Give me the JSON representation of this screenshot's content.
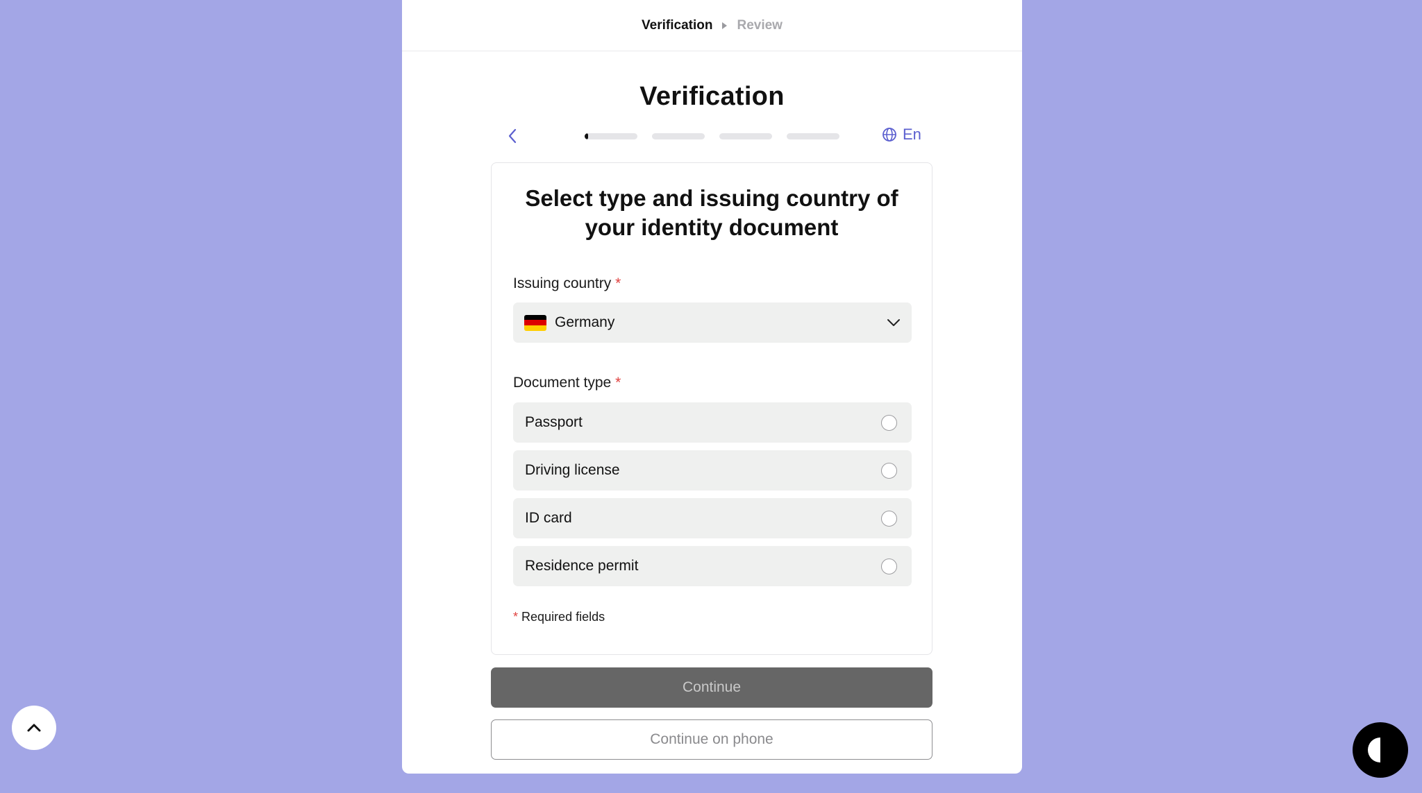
{
  "breadcrumb": {
    "steps": [
      "Verification",
      "Review"
    ],
    "active_index": 0
  },
  "page": {
    "title": "Verification"
  },
  "progress": {
    "segments": 4,
    "current_fraction": 0.06
  },
  "language": {
    "label": "En",
    "icon": "globe-icon"
  },
  "card": {
    "title": "Select type and issuing country of your identity document",
    "country_label": "Issuing country",
    "required_mark": "*",
    "country": {
      "value": "Germany",
      "flag_colors": [
        "#000000",
        "#dd0000",
        "#ffce00"
      ]
    },
    "document_label": "Document type",
    "document_types": [
      {
        "label": "Passport",
        "selected": false
      },
      {
        "label": "Driving license",
        "selected": false
      },
      {
        "label": "ID card",
        "selected": false
      },
      {
        "label": "Residence permit",
        "selected": false
      }
    ],
    "required_note": "Required fields"
  },
  "actions": {
    "continue_label": "Continue",
    "continue_phone_label": "Continue on phone"
  },
  "colors": {
    "background": "#a3a6e6",
    "accent": "#5b5fcf",
    "required": "#e0413f"
  }
}
